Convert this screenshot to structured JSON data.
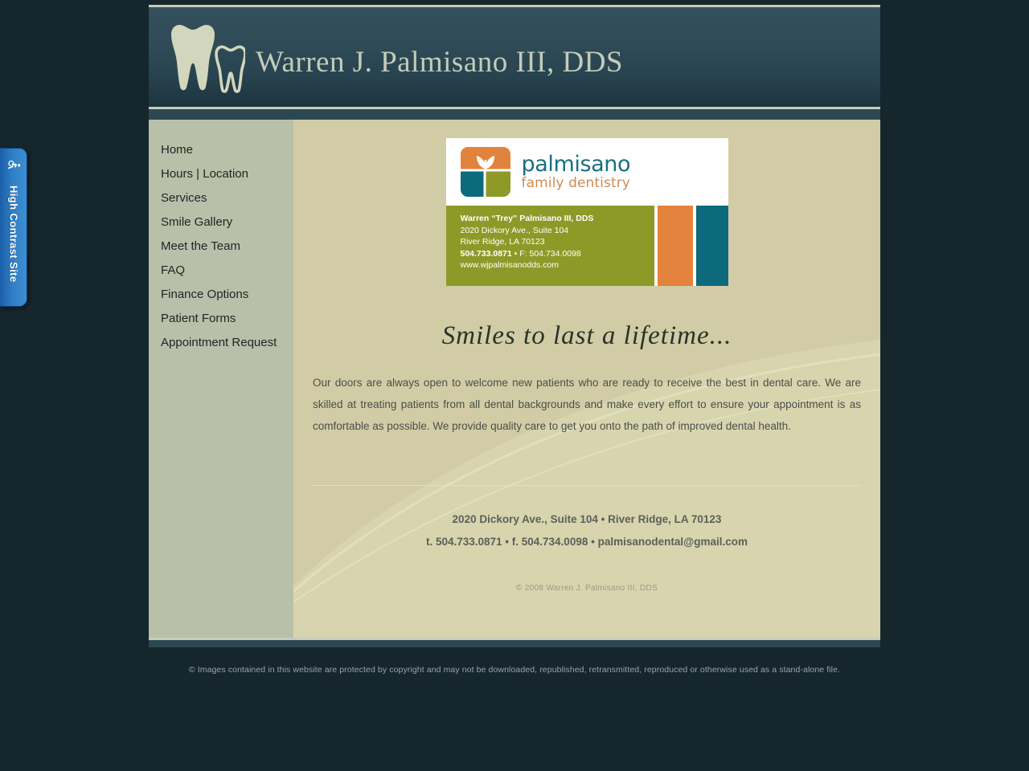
{
  "accessibility_tab": {
    "label": "High Contrast Site",
    "icon": "wheelchair-accessibility-icon",
    "color": "#2f7ec4"
  },
  "header": {
    "title": "Warren J. Palmisano III, DDS",
    "logo_icon": "two-teeth-icon",
    "background_color": "#2e4a56",
    "title_color": "#c3ccba"
  },
  "sidebar": {
    "background_color": "#b9c0a9",
    "items": [
      {
        "label": "Home"
      },
      {
        "label": "Hours | Location"
      },
      {
        "label": "Services"
      },
      {
        "label": "Smile Gallery"
      },
      {
        "label": "Meet the Team"
      },
      {
        "label": "FAQ"
      },
      {
        "label": "Finance Options"
      },
      {
        "label": "Patient Forms"
      },
      {
        "label": "Appointment Request"
      }
    ]
  },
  "business_card": {
    "logo_icon": "palmisano-leaf-logo-icon",
    "wordmark_line1": "palmisano",
    "wordmark_line2": "family dentistry",
    "wordmark_line1_color": "#17707f",
    "wordmark_line2_color": "#d08a52",
    "panel_color": "#8e9a28",
    "accent_orange": "#e4833d",
    "accent_teal": "#0c6a7c",
    "name": "Warren “Trey” Palmisano III, DDS",
    "address_line1": "2020 Dickory Ave., Suite 104",
    "address_line2": "River Ridge, LA 70123",
    "phone_line": "504.733.0871 • F: 504.734.0098",
    "phone_bold": "504.733.0871",
    "fax_rest": " • F: 504.734.0098",
    "website": "www.wjpalmisanodds.com"
  },
  "main": {
    "tagline": "Smiles to last a lifetime...",
    "intro_paragraph": "Our doors are always open to welcome new patients who are ready to receive the best in dental care. We are skilled at treating patients from all dental backgrounds and make every effort to ensure your appointment is as comfortable as possible. We provide quality care to get you onto the path of improved dental health.",
    "background_color": "#d1cca5"
  },
  "footer": {
    "address": "2020 Dickory Ave., Suite 104 • River Ridge, LA  70123",
    "contact": "t. 504.733.0871  •  f. 504.734.0098 •  palmisanodental@gmail.com",
    "copyright": "© 2008 Warren J. Palmisano III, DDS"
  },
  "disclaimer": {
    "text": "© Images contained in this website are protected by copyright and may not be downloaded, republished, retransmitted, reproduced or otherwise used as a stand-alone file."
  }
}
